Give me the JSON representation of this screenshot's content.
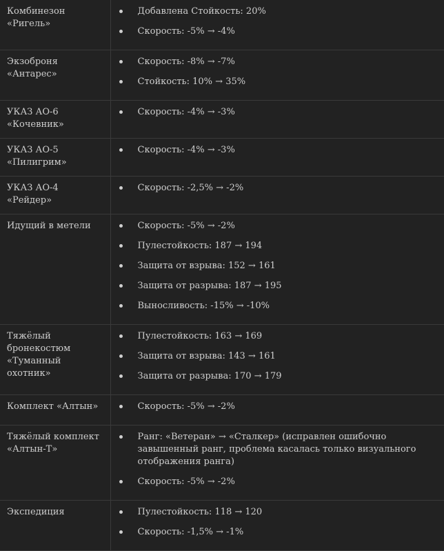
{
  "rows": [
    {
      "name": "Комбинезон «Ригель»",
      "changes": [
        "Добавлена Стойкость: 20%",
        "Скорость: -5% → -4%"
      ]
    },
    {
      "name": "Экзоброня «Антарес»",
      "changes": [
        "Скорость: -8% → -7%",
        "Стойкость: 10% → 35%"
      ]
    },
    {
      "name": "УКАЗ АО-6 «Кочевник»",
      "changes": [
        "Скорость: -4% → -3%"
      ]
    },
    {
      "name": "УКАЗ АО-5 «Пилигрим»",
      "changes": [
        "Скорость: -4% → -3%"
      ]
    },
    {
      "name": "УКАЗ АО-4 «Рейдер»",
      "changes": [
        "Скорость: -2,5% → -2%"
      ]
    },
    {
      "name": "Идущий в метели",
      "changes": [
        "Скорость: -5% → -2%",
        "Пулестойкость: 187 → 194",
        "Защита от взрыва: 152 → 161",
        "Защита от разрыва: 187 → 195",
        "Выносливость: -15% → -10%"
      ]
    },
    {
      "name": "Тяжёлый бронекостюм «Туманный охотник»",
      "changes": [
        "Пулестойкость: 163 → 169",
        "Защита от взрыва: 143 → 161",
        "Защита от разрыва: 170 → 179"
      ]
    },
    {
      "name": "Комплект «Алтын»",
      "changes": [
        "Скорость: -5% → -2%"
      ]
    },
    {
      "name": "Тяжёлый комплект «Алтын-Т»",
      "changes": [
        "Ранг: «Ветеран» → «Сталкер» (исправлен ошибочно завышенный ранг, проблема касалась только визуального отображения ранга)",
        "Скорость: -5% → -2%"
      ]
    },
    {
      "name": "Экспедиция",
      "changes": [
        "Пулестойкость: 118 → 120",
        "Скорость: -1,5% → -1%"
      ]
    }
  ]
}
